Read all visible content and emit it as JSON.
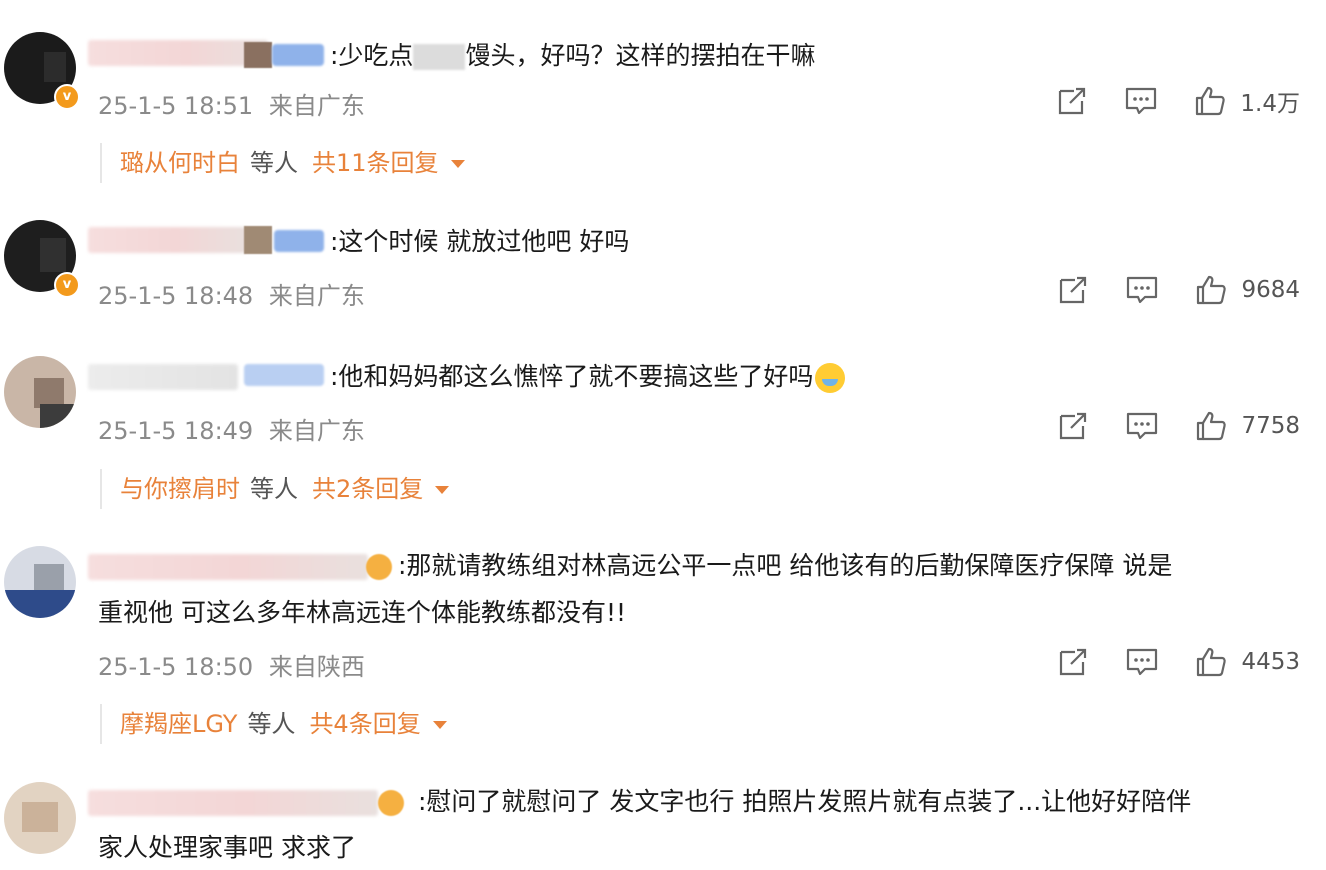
{
  "comments": [
    {
      "text": ":少吃点",
      "text_tail": "馒头，好吗？这样的摆拍在干嘛",
      "time": "25-1-5 18:51",
      "location": "来自广东",
      "likes": "1.4万",
      "reply_name": "璐从何时白",
      "reply_mid": "等人",
      "reply_count": "共11条回复"
    },
    {
      "text": ":这个时候 就放过他吧 好吗",
      "time": "25-1-5 18:48",
      "location": "来自广东",
      "likes": "9684"
    },
    {
      "text": ":他和妈妈都这么憔悴了就不要搞这些了好吗",
      "time": "25-1-5 18:49",
      "location": "来自广东",
      "likes": "7758",
      "reply_name": "与你擦肩时",
      "reply_mid": "等人",
      "reply_count": "共2条回复"
    },
    {
      "text": ":那就请教练组对林高远公平一点吧 给他该有的后勤保障医疗保障 说是",
      "text_line2": "重视他 可这么多年林高远连个体能教练都没有!!",
      "time": "25-1-5 18:50",
      "location": "来自陕西",
      "likes": "4453",
      "reply_name": "摩羯座LGY",
      "reply_mid": "等人",
      "reply_count": "共4条回复"
    },
    {
      "text": ":慰问了就慰问了 发文字也行 拍照片发照片就有点装了...让他好好陪伴",
      "text_line2": "家人处理家事吧 求求了"
    }
  ],
  "icons": {
    "share": "share-icon",
    "comment": "comment-icon",
    "like": "thumbs-up-icon",
    "expand": "caret-down-icon"
  },
  "colors": {
    "accent": "#e8823a",
    "meta": "#8a8a8a",
    "text": "#1a1a1a",
    "verified": "#f39a1c"
  }
}
